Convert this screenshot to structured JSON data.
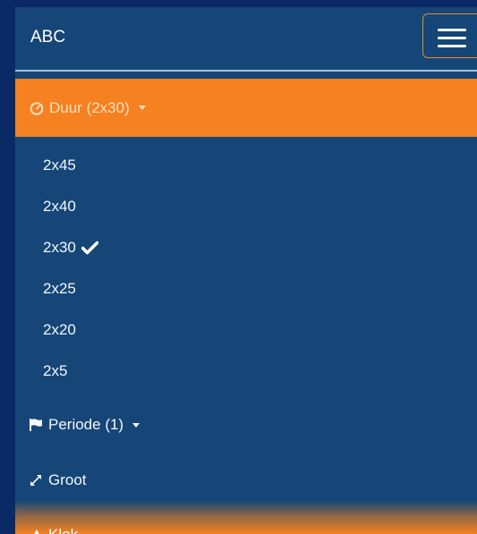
{
  "navbar": {
    "brand": "ABC",
    "menu_toggle_icon": "hamburger-icon"
  },
  "duration_menu": {
    "label": "Duur (2x30)",
    "icon": "stopwatch-icon",
    "options": [
      {
        "label": "2x45",
        "selected": false
      },
      {
        "label": "2x40",
        "selected": false
      },
      {
        "label": "2x30",
        "selected": true
      },
      {
        "label": "2x25",
        "selected": false
      },
      {
        "label": "2x20",
        "selected": false
      },
      {
        "label": "2x5",
        "selected": false
      }
    ]
  },
  "period_menu": {
    "label": "Periode (1)",
    "icon": "flag-icon"
  },
  "large_item": {
    "label": "Groot",
    "icon": "expand-arrows-icon"
  },
  "clock_item": {
    "label": "Klok",
    "icon": "warning-triangle-icon"
  },
  "colors": {
    "background": "#0a2a66",
    "panel": "#154677",
    "accent": "#f58120"
  }
}
